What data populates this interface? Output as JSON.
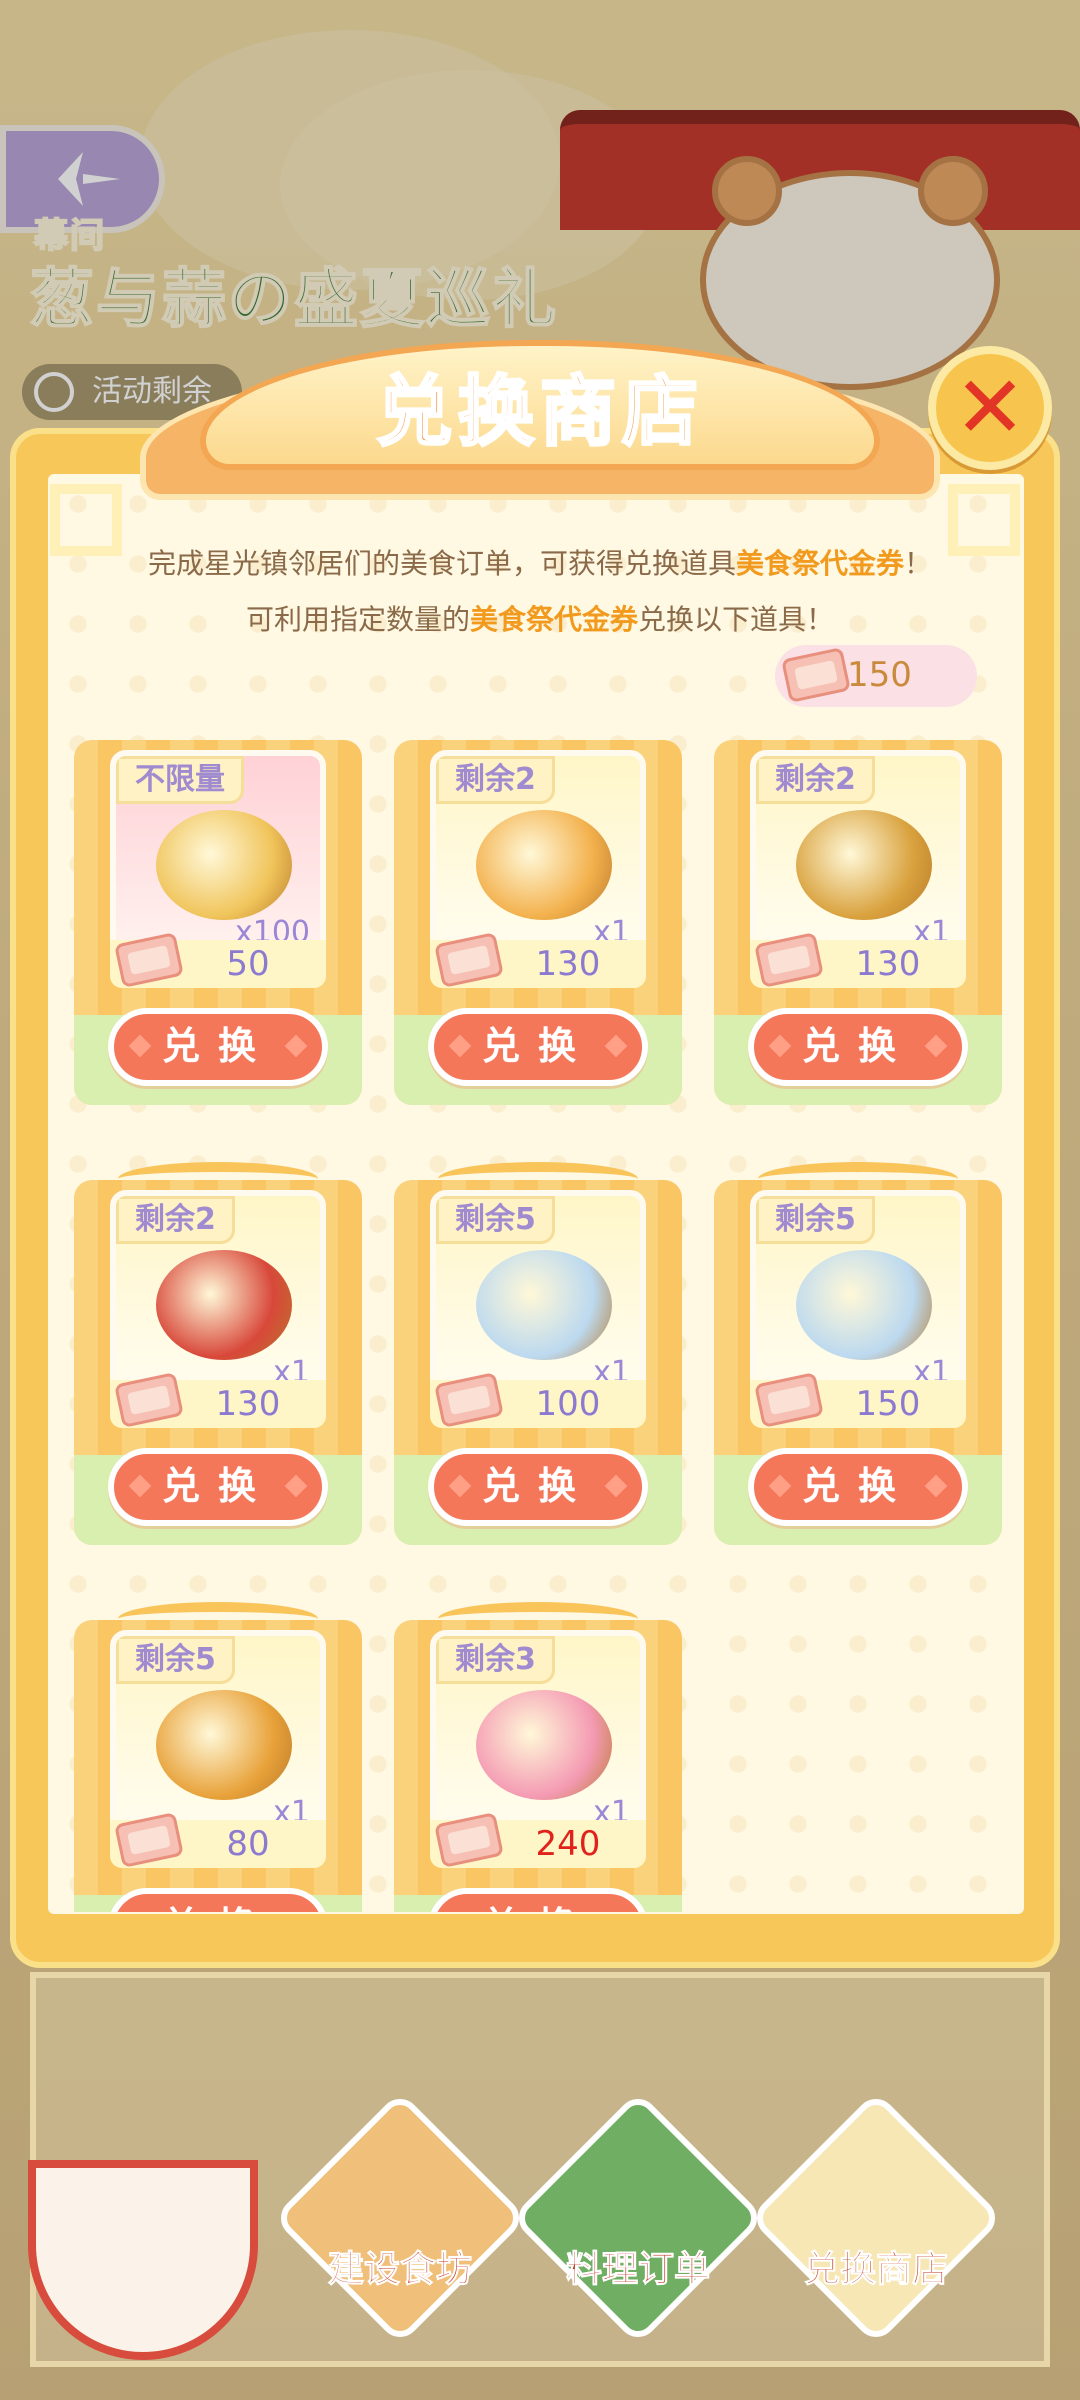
{
  "event": {
    "title": "葱与蒜の盛夏巡礼",
    "tag": "幕间",
    "timer_label": "活动剩余"
  },
  "shop": {
    "title": "兑换商店",
    "description_parts": {
      "p1": "完成星光镇邻居们的美食订单，可获得兑换道具",
      "h1": "美食祭代金券",
      "p2": "！可利用指定数量的",
      "h2": "美食祭代金券",
      "p3": "兑换以下道具！"
    },
    "balance": "150",
    "items": [
      {
        "stock": "不限量",
        "qty": "x100",
        "price": "50",
        "button": "兑换",
        "icon": "gold-coins-icon",
        "bg": "pink"
      },
      {
        "stock": "剩余2",
        "qty": "x1",
        "price": "130",
        "button": "兑换",
        "icon": "crab-dumpling-icon",
        "bg": "yellow"
      },
      {
        "stock": "剩余2",
        "qty": "x1",
        "price": "130",
        "button": "兑换",
        "icon": "golden-pot-icon",
        "bg": "yellow"
      },
      {
        "stock": "剩余2",
        "qty": "x1",
        "price": "130",
        "button": "兑换",
        "icon": "tomato-stew-icon",
        "bg": "yellow"
      },
      {
        "stock": "剩余5",
        "qty": "x1",
        "price": "100",
        "button": "兑换",
        "icon": "sticker-pack-icon",
        "bg": "yellow"
      },
      {
        "stock": "剩余5",
        "qty": "x1",
        "price": "150",
        "button": "兑换",
        "icon": "sticker-pack-icon",
        "bg": "yellow"
      },
      {
        "stock": "剩余5",
        "qty": "x1",
        "price": "80",
        "button": "兑换",
        "icon": "grocery-bag-orange-icon",
        "bg": "yellow"
      },
      {
        "stock": "剩余3",
        "qty": "x1",
        "price": "240",
        "button": "兑换",
        "icon": "grocery-bag-pink-icon",
        "bg": "yellow"
      }
    ]
  },
  "nav": {
    "build": "建设食坊",
    "orders": "料理订单",
    "shop": "兑换商店"
  },
  "colors": {
    "accent": "#f5775a",
    "highlight": "#f29a1e",
    "insufficient_price": "#e0221a",
    "stock_text": "#a08ad0"
  }
}
